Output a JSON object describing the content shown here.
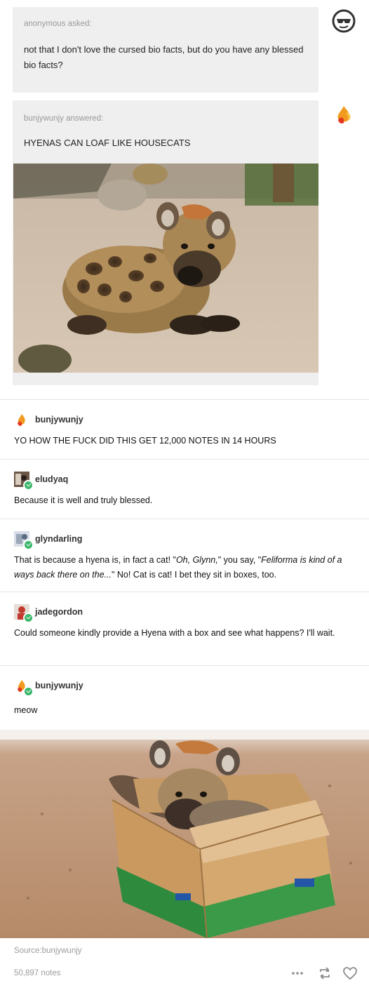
{
  "ask": {
    "asker": "anonymous",
    "asked_label": "asked:",
    "question": "not that I don't love the cursed bio facts, but do you have any blessed bio facts?"
  },
  "answer": {
    "username": "bunjywunjy",
    "answered_label": "answered:",
    "text": "HYENAS CAN LOAF LIKE HOUSECATS"
  },
  "replies": [
    {
      "username": "bunjywunjy",
      "text": "YO HOW THE FUCK DID THIS GET 12,000 NOTES IN 14 HOURS"
    },
    {
      "username": "eludyaq",
      "text": "Because it is well and truly blessed."
    },
    {
      "username": "glyndarling",
      "text_a": "That is because a hyena is, in fact a cat! \"",
      "text_b": "Oh, Glynn,",
      "text_c": "\" you say, \"",
      "text_d": "Feliforma is kind of a ways back there on the...",
      "text_e": "\" No! Cat is cat! I bet they sit in boxes, too."
    },
    {
      "username": "jadegordon",
      "text": "Could someone kindly provide a Hyena with a box and see what happens? I'll wait."
    },
    {
      "username": "bunjywunjy",
      "text": "meow"
    }
  ],
  "footer": {
    "source": "Source:bunjywunjy",
    "notes": "50,897 notes"
  },
  "icons": {
    "more": "more-icon",
    "reblog": "reblog-icon",
    "like": "heart-icon"
  }
}
